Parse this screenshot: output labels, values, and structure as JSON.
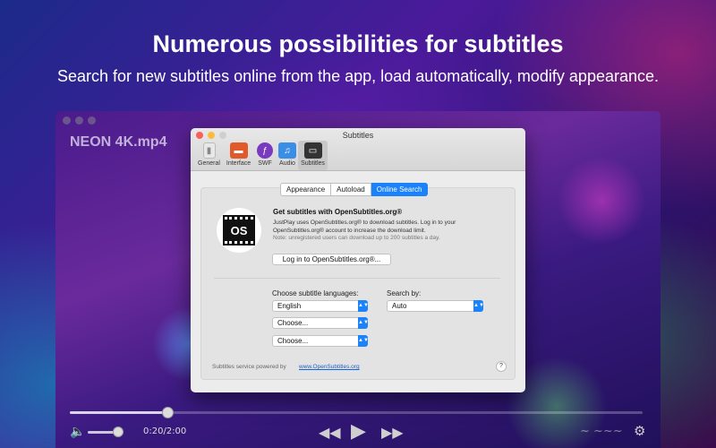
{
  "headline": "Numerous possibilities for subtitles",
  "subheadline": "Search for new subtitles online from the app, load automatically, modify appearance.",
  "player": {
    "video_title": "NEON 4K.mp4",
    "time": "0:20/2:00",
    "seek_progress": 0.17,
    "volume_level": 0.7,
    "icons": [
      "speaker-icon",
      "rewind-icon",
      "play-icon",
      "fast-forward-icon",
      "settings-gear-icon"
    ]
  },
  "prefs": {
    "window_title": "Subtitles",
    "toolbar": [
      {
        "label": "General",
        "icon": "switch-icon"
      },
      {
        "label": "Interface",
        "icon": "interface-icon"
      },
      {
        "label": "SWF",
        "icon": "swf-icon"
      },
      {
        "label": "Audio",
        "icon": "music-note-icon"
      },
      {
        "label": "Subtitles",
        "icon": "speech-bubble-icon"
      }
    ],
    "tabs": [
      "Appearance",
      "Autoload",
      "Online Search"
    ],
    "active_tab": "Online Search",
    "logo_text": "OS",
    "heading": "Get subtitles with OpenSubtitles.org®",
    "description": "JustPlay uses OpenSubtitles.org® to download subtitles. Log in to your OpenSubtitles.org® account to increase the download limit.",
    "note": "Note: unregistered users can download up to 200 subtitles a day.",
    "login_button": "Log in to OpenSubtitles.org®...",
    "languages_label": "Choose subtitle languages:",
    "search_by_label": "Search by:",
    "language_selects": [
      "English",
      "Choose...",
      "Choose..."
    ],
    "search_by_value": "Auto",
    "footer_text": "Subtitles service powered by",
    "footer_link": "www.OpenSubtitles.org",
    "help_label": "?"
  },
  "colors": {
    "accent": "#1a82fb",
    "close": "#fc605b",
    "minimize": "#fdbc40"
  }
}
